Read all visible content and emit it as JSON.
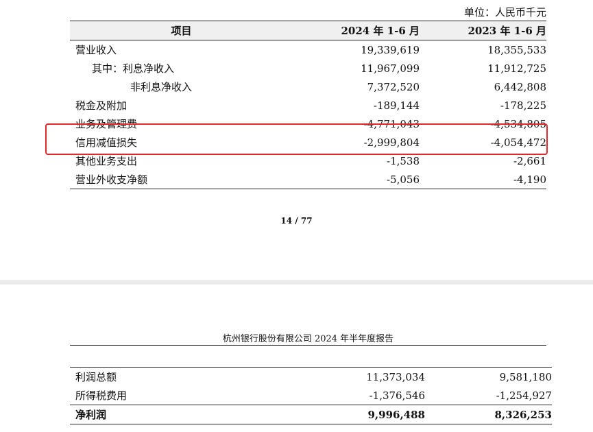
{
  "unit_label": "单位：人民币千元",
  "table1": {
    "header": {
      "item": "项目",
      "col1": "2024 年 1-6 月",
      "col2": "2023 年 1-6 月"
    },
    "rows": [
      {
        "label": "营业收入",
        "v1": "19,339,619",
        "v2": "18,355,533"
      },
      {
        "label": "其中：利息净收入",
        "v1": "11,967,099",
        "v2": "11,912,725"
      },
      {
        "label": "非利息净收入",
        "v1": "7,372,520",
        "v2": "6,442,808"
      },
      {
        "label": "税金及附加",
        "v1": "-189,144",
        "v2": "-178,225"
      },
      {
        "label": "业务及管理费",
        "v1": "-4,771,043",
        "v2": "-4,534,805"
      },
      {
        "label": "信用减值损失",
        "v1": "-2,999,804",
        "v2": "-4,054,472"
      },
      {
        "label": "其他业务支出",
        "v1": "-1,538",
        "v2": "-2,661"
      },
      {
        "label": "营业外收支净额",
        "v1": "-5,056",
        "v2": "-4,190"
      }
    ]
  },
  "page_number": "14 / 77",
  "report_title": "杭州银行股份有限公司 2024 年半年度报告",
  "table2": {
    "rows": [
      {
        "label": "利润总额",
        "v1": "11,373,034",
        "v2": "9,581,180"
      },
      {
        "label": "所得税费用",
        "v1": "-1,376,546",
        "v2": "-1,254,927"
      },
      {
        "label": "净利润",
        "v1": "9,996,488",
        "v2": "8,326,253"
      }
    ]
  },
  "colors": {
    "highlight": "#e02a2a",
    "header_bg": "#f0f0f0",
    "page_gap": "#ececec"
  }
}
